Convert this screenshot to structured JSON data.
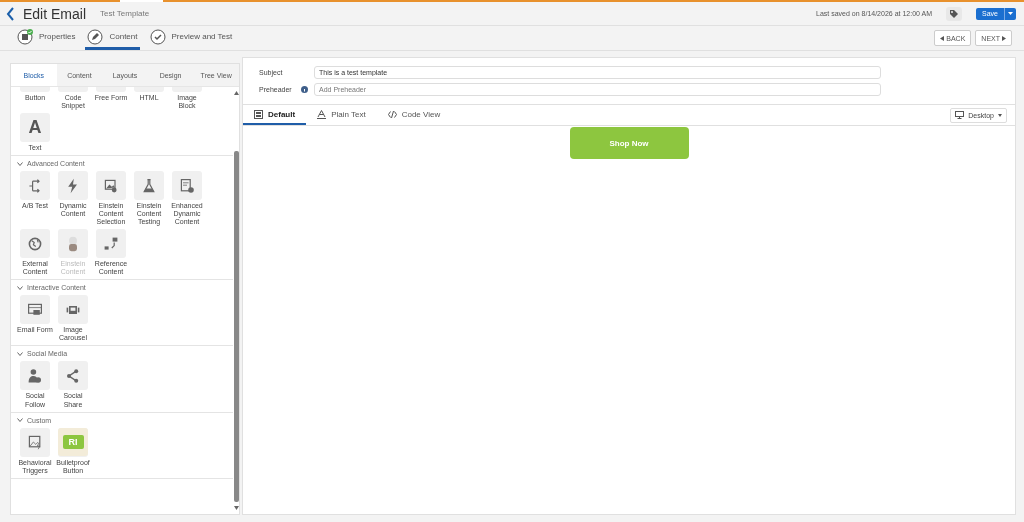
{
  "header": {
    "title": "Edit Email",
    "subtitle": "Test Template",
    "last_saved": "Last saved on 8/14/2026 at 12:00 AM",
    "save_label": "Save"
  },
  "steps": [
    {
      "label": "Properties",
      "selected": false,
      "completed": true
    },
    {
      "label": "Content",
      "selected": true,
      "completed": false
    },
    {
      "label": "Preview and Test",
      "selected": false,
      "completed": false
    }
  ],
  "nav_buttons": [
    "BACK",
    "NEXT"
  ],
  "sidebar": {
    "tabs": [
      {
        "label": "Blocks",
        "selected": true
      },
      {
        "label": "Content",
        "selected": false
      },
      {
        "label": "Layouts",
        "selected": false
      },
      {
        "label": "Design",
        "selected": false
      },
      {
        "label": "Tree View",
        "selected": false
      }
    ],
    "sections": [
      {
        "items": [
          {
            "label": "Button",
            "disabled": false
          },
          {
            "label": "Code Snippet",
            "disabled": false
          },
          {
            "label": "Free Form",
            "disabled": false
          },
          {
            "label": "HTML",
            "disabled": false
          },
          {
            "label": "Image Block",
            "disabled": false
          },
          {
            "label": "Text",
            "disabled": false,
            "glyph": "A"
          }
        ]
      },
      {
        "title": "Advanced Content",
        "expanded": true,
        "items": [
          {
            "label": "A/B Test",
            "disabled": false
          },
          {
            "label": "Dynamic Content",
            "disabled": false
          },
          {
            "label": "Einstein Content Selection",
            "disabled": false
          },
          {
            "label": "Einstein Content Testing",
            "disabled": false
          },
          {
            "label": "Enhanced Dynamic Content",
            "disabled": false
          },
          {
            "label": "External Content",
            "disabled": false
          },
          {
            "label": "Einstein Content",
            "disabled": true
          },
          {
            "label": "Reference Content",
            "disabled": false
          }
        ]
      },
      {
        "title": "Interactive Content",
        "expanded": true,
        "items": [
          {
            "label": "Email Form",
            "disabled": false
          },
          {
            "label": "Image Carousel",
            "disabled": false
          }
        ]
      },
      {
        "title": "Social Media",
        "expanded": true,
        "items": [
          {
            "label": "Social Follow",
            "disabled": false
          },
          {
            "label": "Social Share",
            "disabled": false
          }
        ]
      },
      {
        "title": "Custom",
        "expanded": true,
        "items": [
          {
            "label": "Behavioral Triggers",
            "disabled": false
          },
          {
            "label": "Bulletproof Button",
            "disabled": false,
            "glyph": "RI"
          }
        ]
      }
    ]
  },
  "email": {
    "subject_label": "Subject",
    "subject": "This is a test template",
    "preheader_label": "Preheader",
    "preheader_placeholder": "Add Preheader"
  },
  "editor_tabs": [
    {
      "label": "Default",
      "selected": true
    },
    {
      "label": "Plain Text",
      "selected": false
    },
    {
      "label": "Code View",
      "selected": false
    }
  ],
  "device": "Desktop",
  "canvas": {
    "button_label": "Shop Now"
  }
}
